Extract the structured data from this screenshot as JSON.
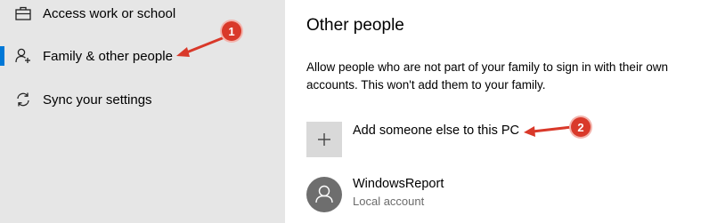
{
  "sidebar": {
    "items": [
      {
        "label": "Access work or school",
        "icon": "briefcase-icon"
      },
      {
        "label": "Family & other people",
        "icon": "add-person-icon"
      },
      {
        "label": "Sync your settings",
        "icon": "sync-icon"
      }
    ],
    "selected_index": 1,
    "accent": "#0078d7"
  },
  "main": {
    "heading": "Other people",
    "description": "Allow people who are not part of your family to sign in with their own accounts. This won't add them to your family.",
    "add_button_label": "Add someone else to this PC",
    "account": {
      "name": "WindowsReport",
      "type": "Local account"
    }
  },
  "annotations": {
    "callout_1": "1",
    "callout_2": "2",
    "color": "#d9392a"
  }
}
